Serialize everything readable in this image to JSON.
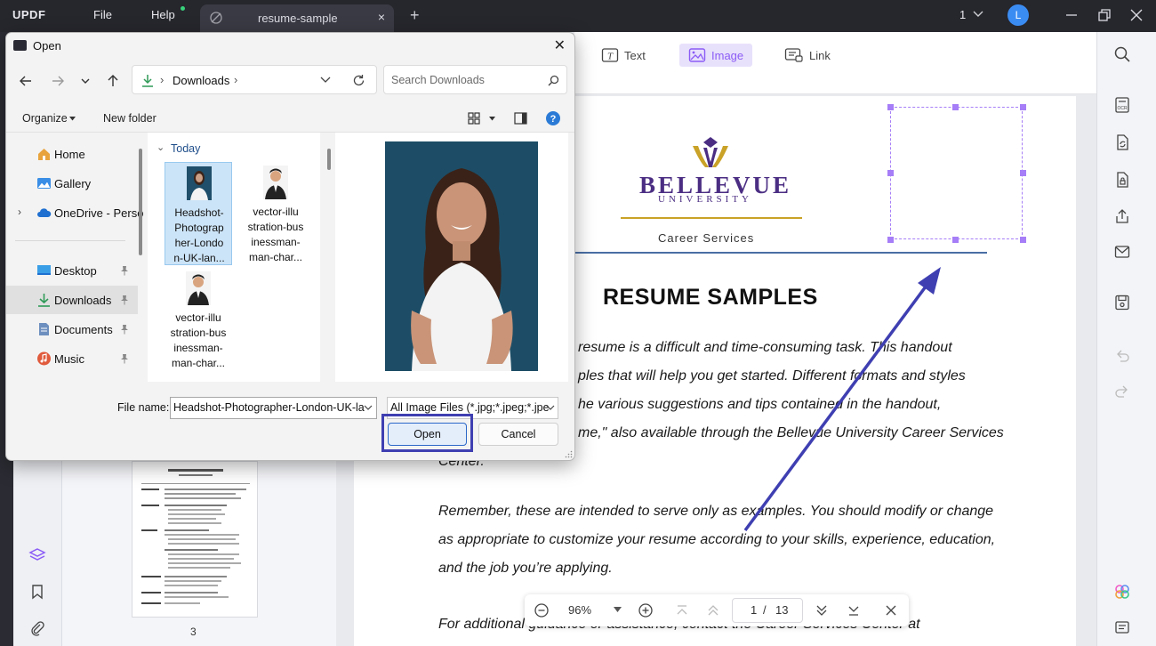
{
  "app": {
    "logo": "UPDF",
    "menu_file": "File",
    "menu_help": "Help",
    "tab_title": "resume-sample",
    "tab_close": "×",
    "tab_add": "+",
    "page_count": "1",
    "avatar_initial": "L"
  },
  "toolbar": {
    "text_label": "Text",
    "image_label": "Image",
    "link_label": "Link"
  },
  "document": {
    "university_name": "BELLEVUE",
    "university_sub": "UNIVERSITY",
    "career_services": "Career Services",
    "title": "RESUME SAMPLES",
    "para1_line1": "resume is a difficult and time-consuming task.  This handout",
    "para1_line2": "ples that will help you get started.  Different formats and styles",
    "para1_line3": "he various suggestions and tips contained in the handout,",
    "para1_line4": "me,\" also available through the Bellevue University Career Services",
    "para1_line5": "Center.",
    "para2_line1": "Remember, these are intended to serve only as examples.  You should modify or change",
    "para2_line2": "as appropriate to customize your resume according to your skills, experience, education,",
    "para2_line3": "and the job you’re applying.",
    "para3_line1": "For additional guidance or assistance, contact the Career Services Center at"
  },
  "thumbnail": {
    "page_number": "3"
  },
  "zoombar": {
    "zoom": "96%",
    "current_page": "1",
    "separator": "/",
    "total_pages": "13"
  },
  "dialog": {
    "title": "Open",
    "address": "Downloads",
    "search_placeholder": "Search Downloads",
    "organize": "Organize",
    "new_folder": "New folder",
    "nav_items": [
      {
        "label": "Home"
      },
      {
        "label": "Gallery"
      },
      {
        "label": "OneDrive - Perso"
      },
      {
        "label": "Desktop"
      },
      {
        "label": "Downloads"
      },
      {
        "label": "Documents"
      },
      {
        "label": "Music"
      }
    ],
    "group_header": "Today",
    "files": [
      {
        "name": "Headshot-\nPhotograp\nher-Londo\nn-UK-lan..."
      },
      {
        "name": "vector-illu\nstration-bus\ninessman-\nman-char..."
      },
      {
        "name": "vector-illu\nstration-bus\ninessman-\nman-char..."
      }
    ],
    "file_name_label": "File name:",
    "file_name_value": "Headshot-Photographer-London-UK-la",
    "file_type": "All Image Files (*.jpg;*.jpeg;*.jpe",
    "open_button": "Open",
    "cancel_button": "Cancel"
  },
  "colors": {
    "accent": "#8b5cf6",
    "university_purple": "#4b2e83",
    "gold": "#c9a227",
    "annotation": "#3f3fb2"
  }
}
